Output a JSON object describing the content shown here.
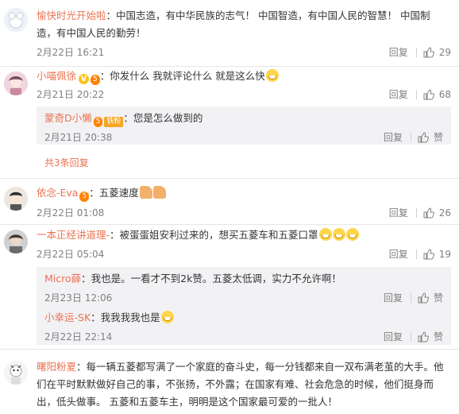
{
  "comments": [
    {
      "user": "愉快时光开始啦",
      "text": "：中国志造，有中华民族的志气！ 中国智造，有中国人民的智慧！ 中国制造，有中国人民的勤劳！",
      "time": "2月22日 16:21",
      "reply_label": "回复",
      "likes": "29"
    },
    {
      "user": "小喵佩徐",
      "text": "：你发什么 我就评论什么 就是这么快",
      "time": "2月21日 20:22",
      "reply_label": "回复",
      "likes": "68",
      "replies": [
        {
          "user": "蒙奇D小懒",
          "fan_badge": "铁粉",
          "text": "：您是怎么做到的",
          "time": "2月21日 20:38",
          "reply_label": "回复",
          "like_label": "赞"
        }
      ],
      "more_replies": "共3条回复"
    },
    {
      "user": "依念-Eva",
      "text": "：五菱速度",
      "time": "2月22日 01:08",
      "reply_label": "回复",
      "likes": "26"
    },
    {
      "user": "一本正经讲道理-",
      "text": "：被蛋蛋姐安利过来的，想买五菱车和五菱口罩",
      "time": "2月22日 05:04",
      "reply_label": "回复",
      "likes": "19",
      "replies": [
        {
          "user": "Micro薛",
          "text": "：我也是。一看才不到2k赞。五菱太低调，实力不允许啊！",
          "time": "2月23日 12:06",
          "reply_label": "回复",
          "like_label": "赞"
        },
        {
          "user": "小幸运-SK",
          "text": "：我我我我也是",
          "time": "2月22日 22:14",
          "reply_label": "回复",
          "like_label": "赞"
        }
      ]
    },
    {
      "user": "曙阳粉夏",
      "text": "：每一辆五菱都写满了一个家庭的奋斗史，每一分钱都来自一双布满老茧的大手。他们在平时默默做好自己的事，不张扬，不外露；在国家有难、社会危急的时候，他们挺身而出，低头做事。 五菱和五菱车主，明明是这个国家最可爱的一批人！"
    }
  ],
  "badges": {
    "vip": "5",
    "verified": "V"
  },
  "colors": {
    "username": "#eb7350",
    "meta": "#808080",
    "reply_bg": "#f2f2f5"
  }
}
